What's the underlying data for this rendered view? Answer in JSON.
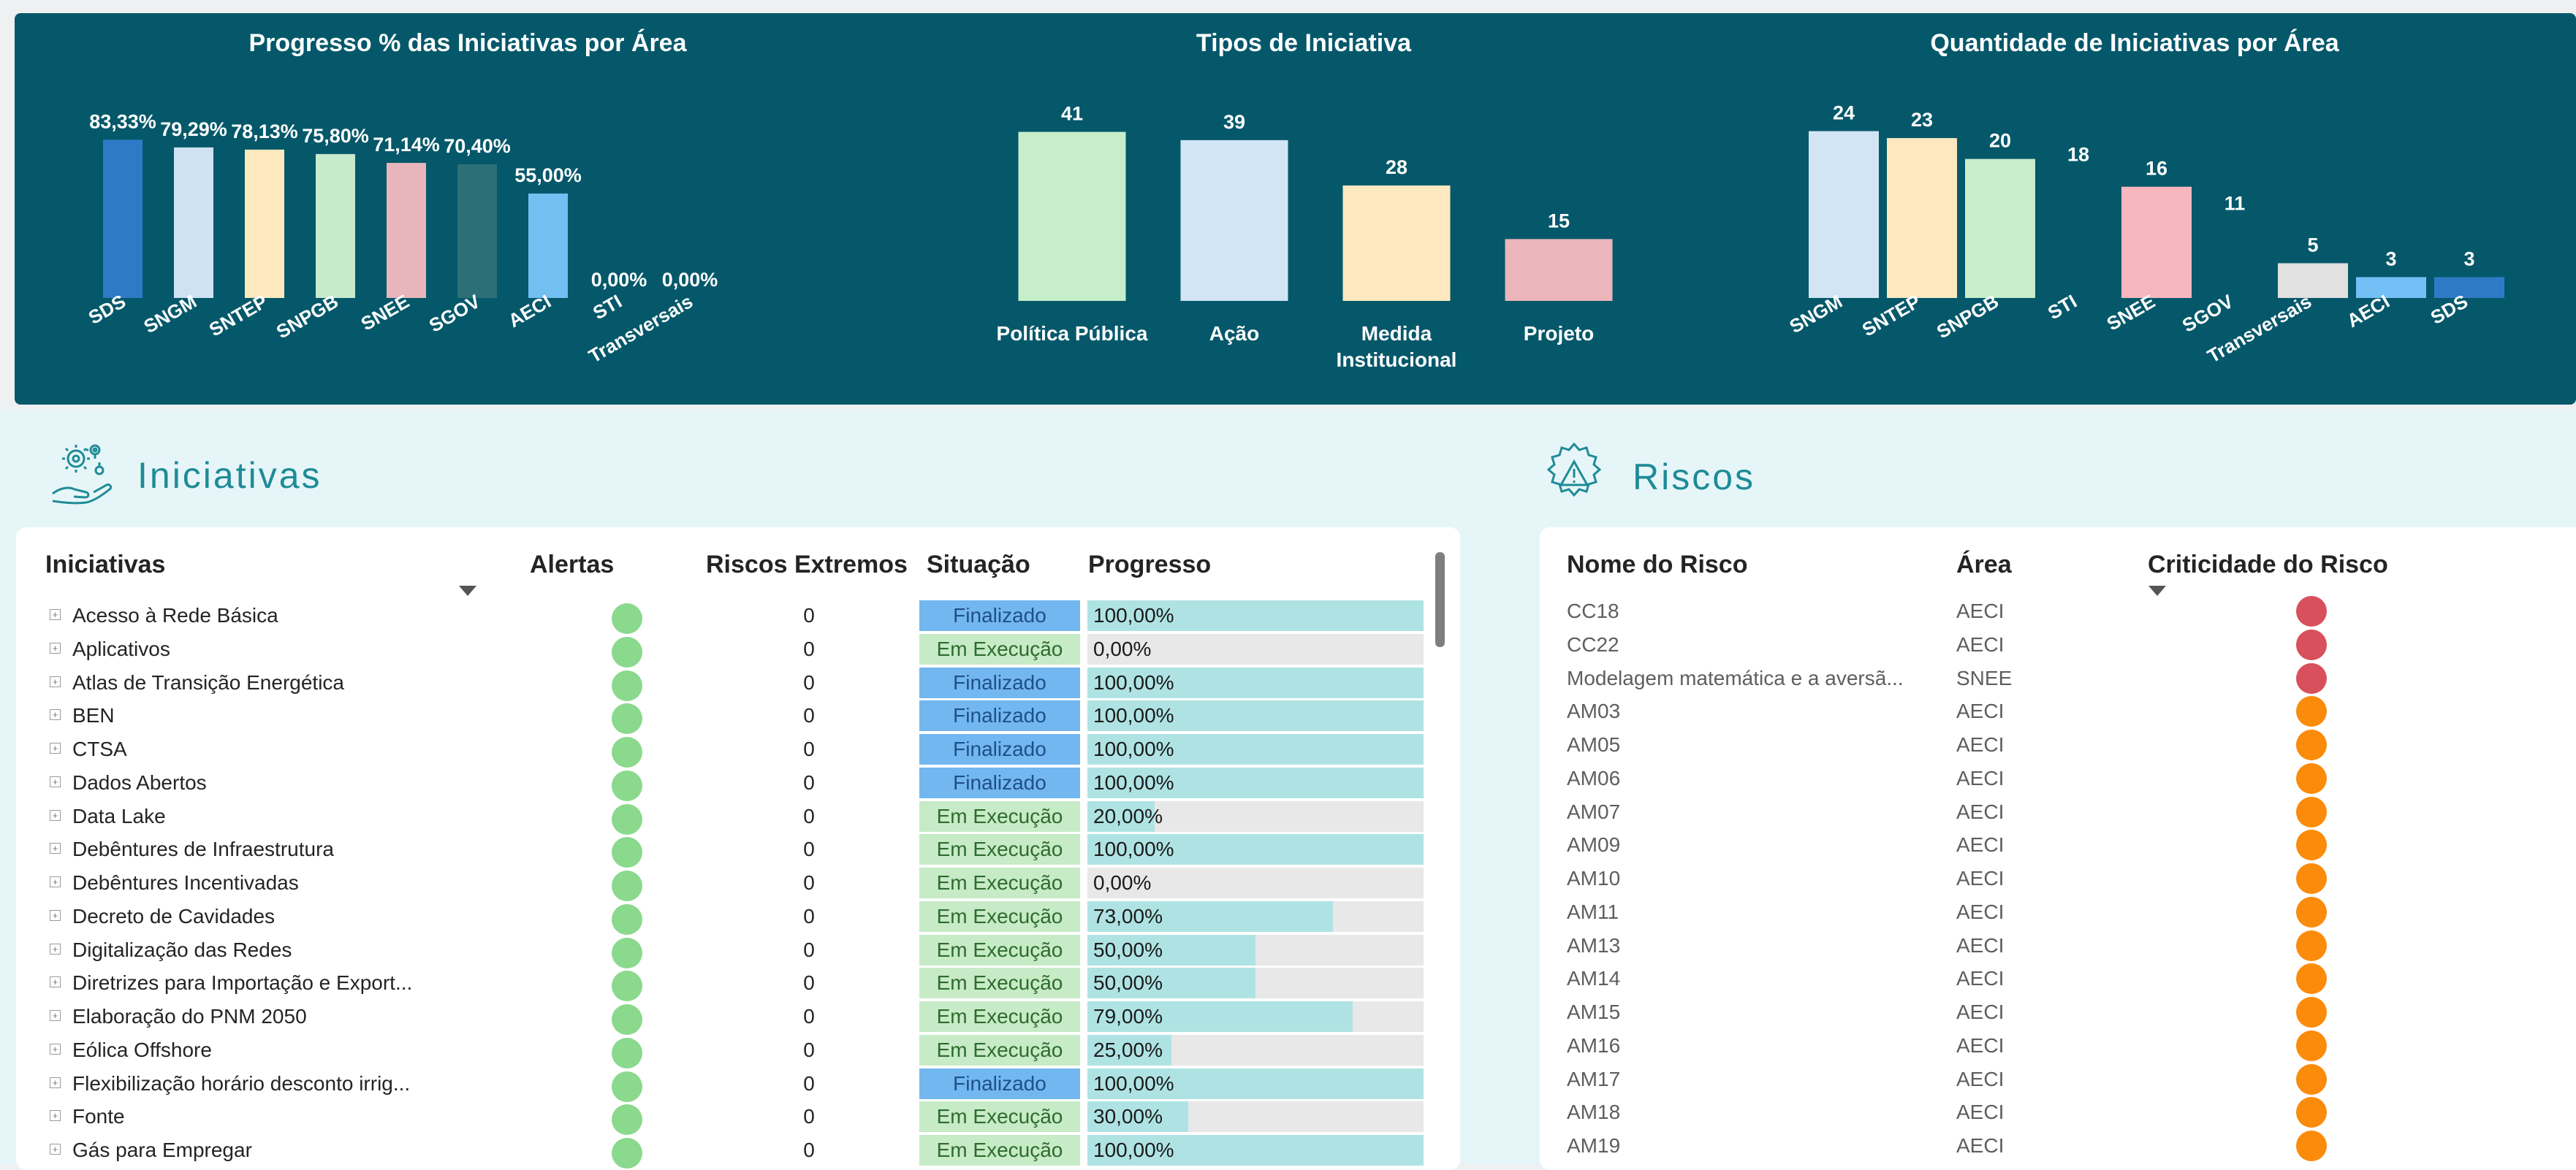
{
  "chart_data": [
    {
      "type": "bar",
      "title": "Progresso % das Iniciativas por Área",
      "categories": [
        "SDS",
        "SNGM",
        "SNTEP",
        "SNPGB",
        "SNEE",
        "SGOV",
        "AECI",
        "STI",
        "Transversais"
      ],
      "values": [
        83.33,
        79.29,
        78.13,
        75.8,
        71.14,
        70.4,
        55.0,
        0.0,
        0.0
      ],
      "labels": [
        "83,33%",
        "79,29%",
        "78,13%",
        "75,80%",
        "71,14%",
        "70,40%",
        "55,00%",
        "0,00%",
        "0,00%"
      ],
      "colors": [
        "#2f7ac6",
        "#cfe2f3",
        "#fde9bd",
        "#c6ebcc",
        "#e8b5bd",
        "#2d6f76",
        "#72bff2",
        "#72bff2",
        "#72bff2"
      ],
      "ylim": [
        0,
        100
      ]
    },
    {
      "type": "bar",
      "title": "Tipos de Iniciativa",
      "categories": [
        "Política Pública",
        "Ação",
        "Medida Institucional",
        "Projeto"
      ],
      "category_lines": [
        [
          "Política Pública"
        ],
        [
          "Ação"
        ],
        [
          "Medida",
          "Institucional"
        ],
        [
          "Projeto"
        ]
      ],
      "values": [
        41,
        39,
        28,
        15
      ],
      "labels": [
        "41",
        "39",
        "28",
        "15"
      ],
      "colors": [
        "#c6eecb",
        "#d2e5f5",
        "#fde8bf",
        "#ebb5bc"
      ],
      "ylim": [
        0,
        45
      ]
    },
    {
      "type": "bar",
      "title": "Quantidade de Iniciativas por Área",
      "categories": [
        "SNGM",
        "SNTEP",
        "SNPGB",
        "STI",
        "SNEE",
        "SGOV",
        "Transversais",
        "AECI",
        "SDS"
      ],
      "values": [
        24,
        23,
        20,
        18,
        16,
        11,
        5,
        3,
        3
      ],
      "labels": [
        "24",
        "23",
        "20",
        "18",
        "16",
        "11",
        "5",
        "3",
        "3"
      ],
      "colors": [
        "#d2e5f5",
        "#fde8bf",
        "#c6eecb",
        "#05586a",
        "#f7b7c0",
        "#05586a",
        "#e1e1e1",
        "#74bff5",
        "#2f7ac6"
      ],
      "ylim": [
        0,
        27
      ]
    }
  ],
  "colors": {
    "panel": "#05586a",
    "accent": "#1f8b97",
    "finalizado": "#72b7f0",
    "em_execucao": "#c6ebc6",
    "alert_green": "#8ad98d",
    "risk_red": "#d7505b",
    "risk_orange": "#fb8b0a",
    "progress": "#afe3e3"
  },
  "iniciativas": {
    "section_title": "Iniciativas",
    "icon": "gears-hand-icon",
    "headers": {
      "iniciativas": "Iniciativas",
      "alertas": "Alertas",
      "riscos": "Riscos Extremos",
      "situacao": "Situação",
      "progresso": "Progresso"
    },
    "rows": [
      {
        "name": "Acesso à Rede Básica",
        "riscos": "0",
        "situacao": "Finalizado",
        "progresso": "100,00%",
        "value": 100
      },
      {
        "name": "Aplicativos",
        "riscos": "0",
        "situacao": "Em Execução",
        "progresso": "0,00%",
        "value": 0
      },
      {
        "name": "Atlas de Transição Energética",
        "riscos": "0",
        "situacao": "Finalizado",
        "progresso": "100,00%",
        "value": 100
      },
      {
        "name": "BEN",
        "riscos": "0",
        "situacao": "Finalizado",
        "progresso": "100,00%",
        "value": 100
      },
      {
        "name": "CTSA",
        "riscos": "0",
        "situacao": "Finalizado",
        "progresso": "100,00%",
        "value": 100
      },
      {
        "name": "Dados Abertos",
        "riscos": "0",
        "situacao": "Finalizado",
        "progresso": "100,00%",
        "value": 100
      },
      {
        "name": "Data Lake",
        "riscos": "0",
        "situacao": "Em Execução",
        "progresso": "20,00%",
        "value": 20
      },
      {
        "name": "Debêntures de Infraestrutura",
        "riscos": "0",
        "situacao": "Em Execução",
        "progresso": "100,00%",
        "value": 100
      },
      {
        "name": "Debêntures Incentivadas",
        "riscos": "0",
        "situacao": "Em Execução",
        "progresso": "0,00%",
        "value": 0
      },
      {
        "name": "Decreto de Cavidades",
        "riscos": "0",
        "situacao": "Em Execução",
        "progresso": "73,00%",
        "value": 73
      },
      {
        "name": "Digitalização das Redes",
        "riscos": "0",
        "situacao": "Em Execução",
        "progresso": "50,00%",
        "value": 50
      },
      {
        "name": "Diretrizes para Importação e Export...",
        "riscos": "0",
        "situacao": "Em Execução",
        "progresso": "50,00%",
        "value": 50
      },
      {
        "name": "Elaboração do PNM 2050",
        "riscos": "0",
        "situacao": "Em Execução",
        "progresso": "79,00%",
        "value": 79
      },
      {
        "name": "Eólica Offshore",
        "riscos": "0",
        "situacao": "Em Execução",
        "progresso": "25,00%",
        "value": 25
      },
      {
        "name": "Flexibilização horário desconto irrig...",
        "riscos": "0",
        "situacao": "Finalizado",
        "progresso": "100,00%",
        "value": 100
      },
      {
        "name": "Fonte",
        "riscos": "0",
        "situacao": "Em Execução",
        "progresso": "30,00%",
        "value": 30
      },
      {
        "name": "Gás para Empregar",
        "riscos": "0",
        "situacao": "Em Execução",
        "progresso": "100,00%",
        "value": 100
      }
    ]
  },
  "riscos": {
    "section_title": "Riscos",
    "icon": "gear-warning-icon",
    "headers": {
      "nome": "Nome do Risco",
      "area": "Área",
      "criticidade": "Criticidade do Risco"
    },
    "rows": [
      {
        "nome": "CC18",
        "area": "AECI",
        "level": "extremo"
      },
      {
        "nome": "CC22",
        "area": "AECI",
        "level": "extremo"
      },
      {
        "nome": "Modelagem matemática e a aversã...",
        "area": "SNEE",
        "level": "extremo"
      },
      {
        "nome": "AM03",
        "area": "AECI",
        "level": "alto"
      },
      {
        "nome": "AM05",
        "area": "AECI",
        "level": "alto"
      },
      {
        "nome": "AM06",
        "area": "AECI",
        "level": "alto"
      },
      {
        "nome": "AM07",
        "area": "AECI",
        "level": "alto"
      },
      {
        "nome": "AM09",
        "area": "AECI",
        "level": "alto"
      },
      {
        "nome": "AM10",
        "area": "AECI",
        "level": "alto"
      },
      {
        "nome": "AM11",
        "area": "AECI",
        "level": "alto"
      },
      {
        "nome": "AM13",
        "area": "AECI",
        "level": "alto"
      },
      {
        "nome": "AM14",
        "area": "AECI",
        "level": "alto"
      },
      {
        "nome": "AM15",
        "area": "AECI",
        "level": "alto"
      },
      {
        "nome": "AM16",
        "area": "AECI",
        "level": "alto"
      },
      {
        "nome": "AM17",
        "area": "AECI",
        "level": "alto"
      },
      {
        "nome": "AM18",
        "area": "AECI",
        "level": "alto"
      },
      {
        "nome": "AM19",
        "area": "AECI",
        "level": "alto"
      }
    ]
  }
}
